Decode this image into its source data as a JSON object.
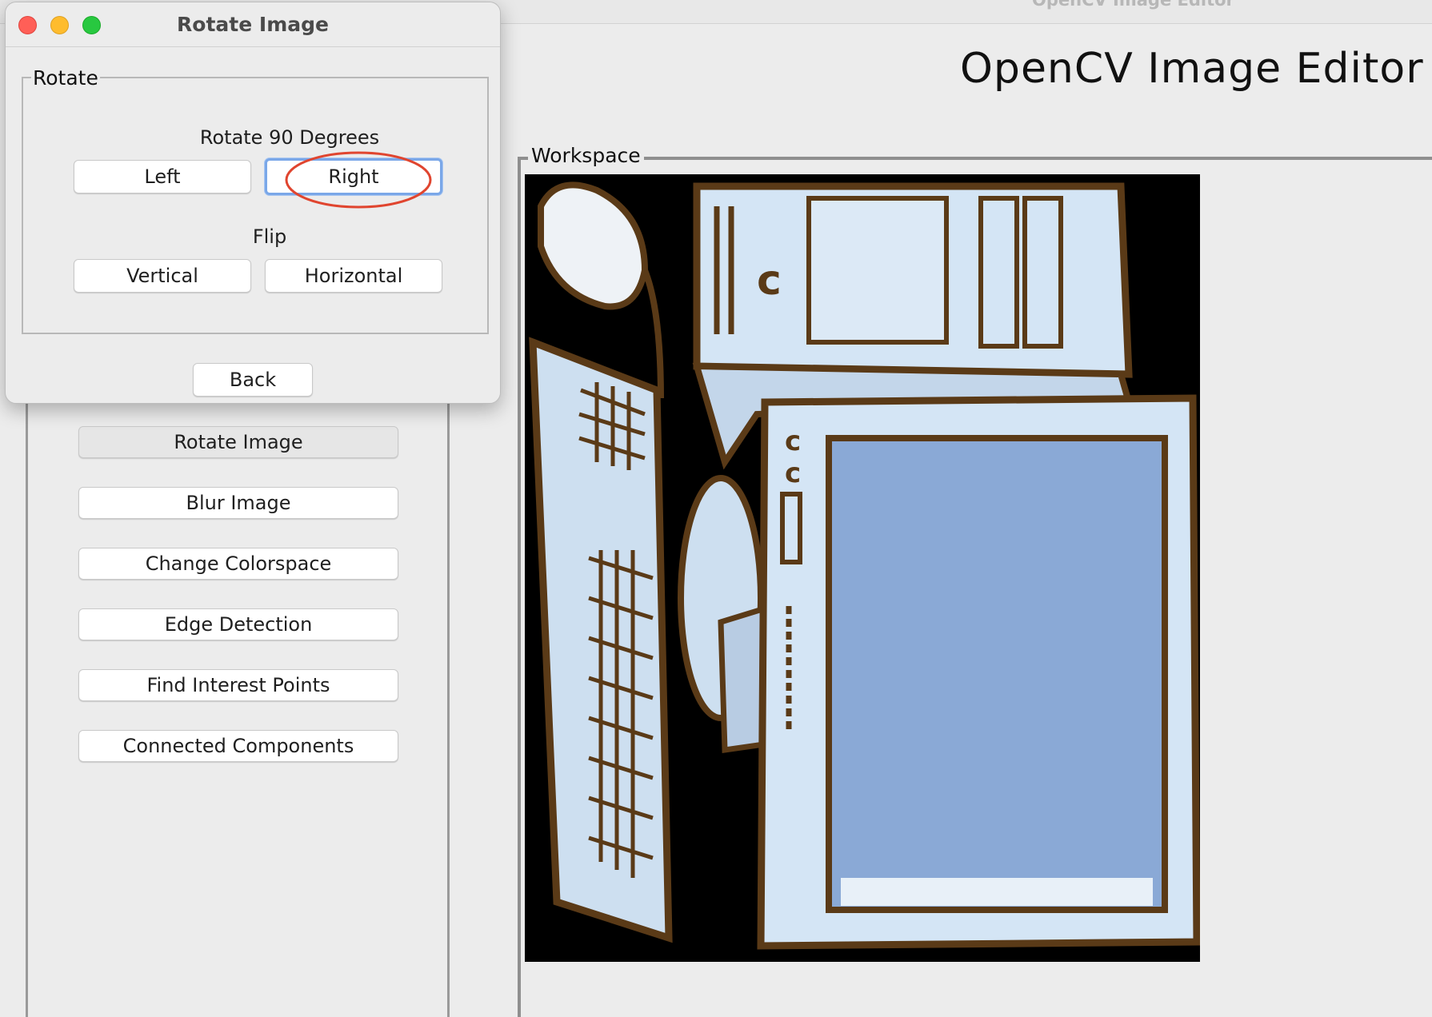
{
  "main_window": {
    "title": "OpenCV Image Editor",
    "heading": "OpenCV Image Editor"
  },
  "sidebar": {
    "buttons": [
      {
        "label": "Rotate Image"
      },
      {
        "label": "Blur Image"
      },
      {
        "label": "Change Colorspace"
      },
      {
        "label": "Edge Detection"
      },
      {
        "label": "Find Interest Points"
      },
      {
        "label": "Connected Components"
      }
    ]
  },
  "workspace": {
    "legend": "Workspace"
  },
  "dialog": {
    "title": "Rotate Image",
    "group_legend": "Rotate",
    "rotate_label": "Rotate 90 Degrees",
    "left_label": "Left",
    "right_label": "Right",
    "flip_label": "Flip",
    "vertical_label": "Vertical",
    "horizontal_label": "Horizontal",
    "back_label": "Back"
  },
  "colors": {
    "annotation": "#e0452f",
    "focus_ring": "#7aa7e8",
    "close": "#ff5f57",
    "minimize": "#febc2e",
    "maximize": "#28c840"
  },
  "icons": [
    "close-icon",
    "minimize-icon",
    "maximize-icon"
  ]
}
